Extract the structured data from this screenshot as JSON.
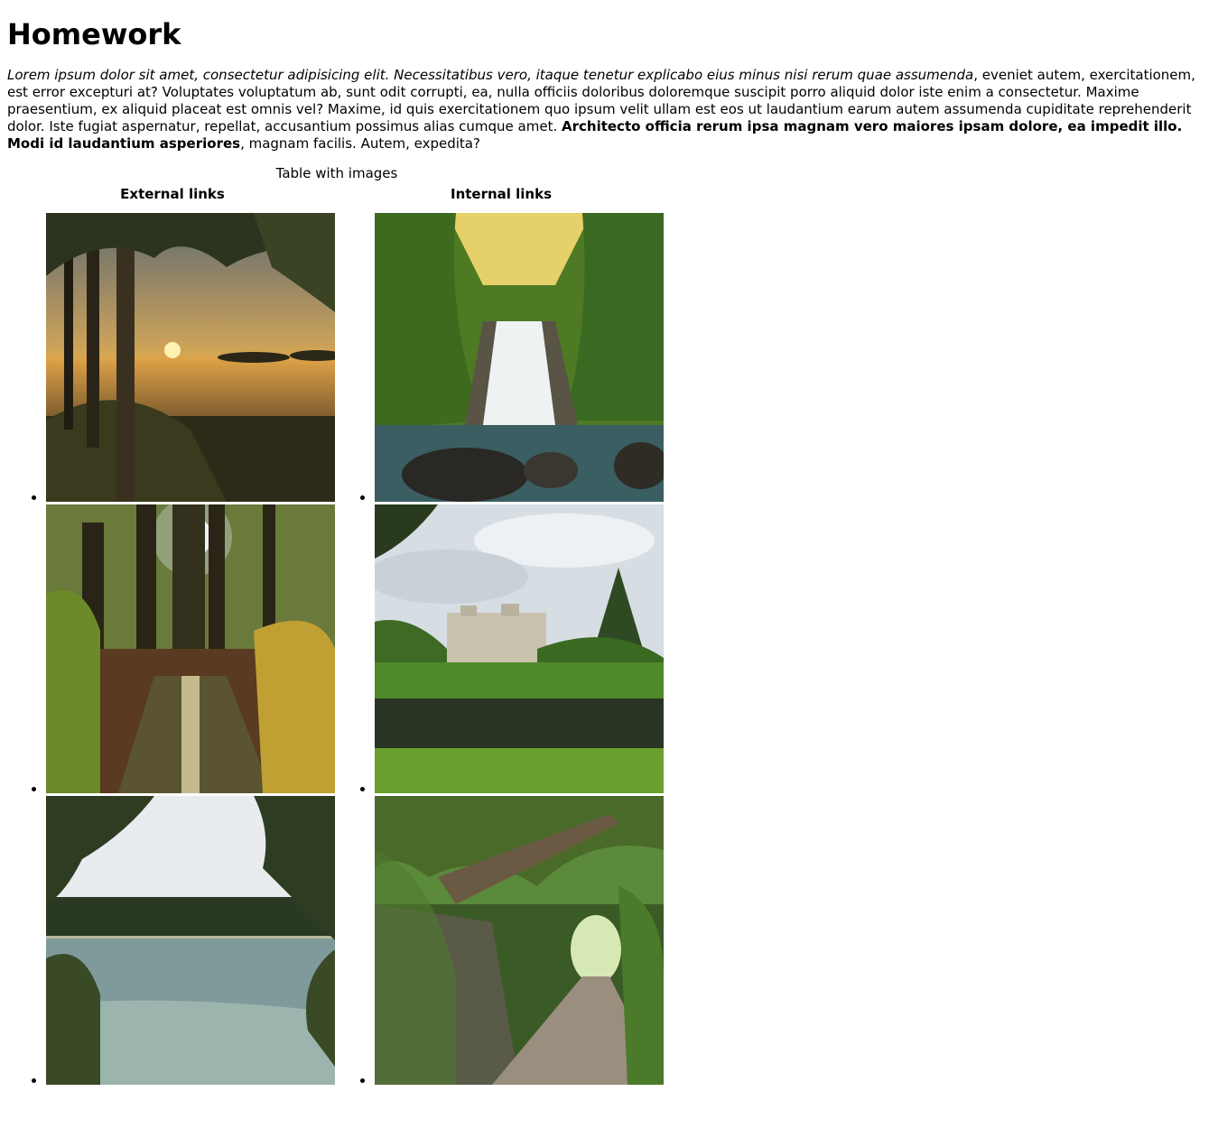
{
  "page": {
    "title": "Homework",
    "intro": {
      "italic": "Lorem ipsum dolor sit amet, consectetur adipisicing elit. Necessitatibus vero, itaque tenetur explicabo eius minus nisi rerum quae assumenda",
      "plain1": ", eveniet autem, exercitationem, est error excepturi at? Voluptates voluptatum ab, sunt odit corrupti, ea, nulla officiis doloribus doloremque suscipit porro aliquid dolor iste enim a consectetur. Maxime praesentium, ex aliquid placeat est omnis vel? Maxime, id quis exercitationem quo ipsum velit ullam est eos ut laudantium earum autem assumenda cupiditate reprehenderit dolor. Iste fugiat aspernatur, repellat, accusantium possimus alias cumque amet. ",
      "bold": "Architecto officia rerum ipsa magnam vero maiores ipsam dolore, ea impedit illo. Modi id laudantium asperiores",
      "plain2": ", magnam facilis. Autem, expedita?"
    }
  },
  "table": {
    "caption": "Table with images",
    "headers": [
      "External links",
      "Internal links"
    ],
    "external_images": [
      {
        "subject": "lake sunset through trees"
      },
      {
        "subject": "sunlit forest boardwalk"
      },
      {
        "subject": "lake framed by trees"
      }
    ],
    "internal_images": [
      {
        "subject": "jungle waterfall"
      },
      {
        "subject": "castle by river"
      },
      {
        "subject": "tree tunnel path"
      }
    ]
  }
}
